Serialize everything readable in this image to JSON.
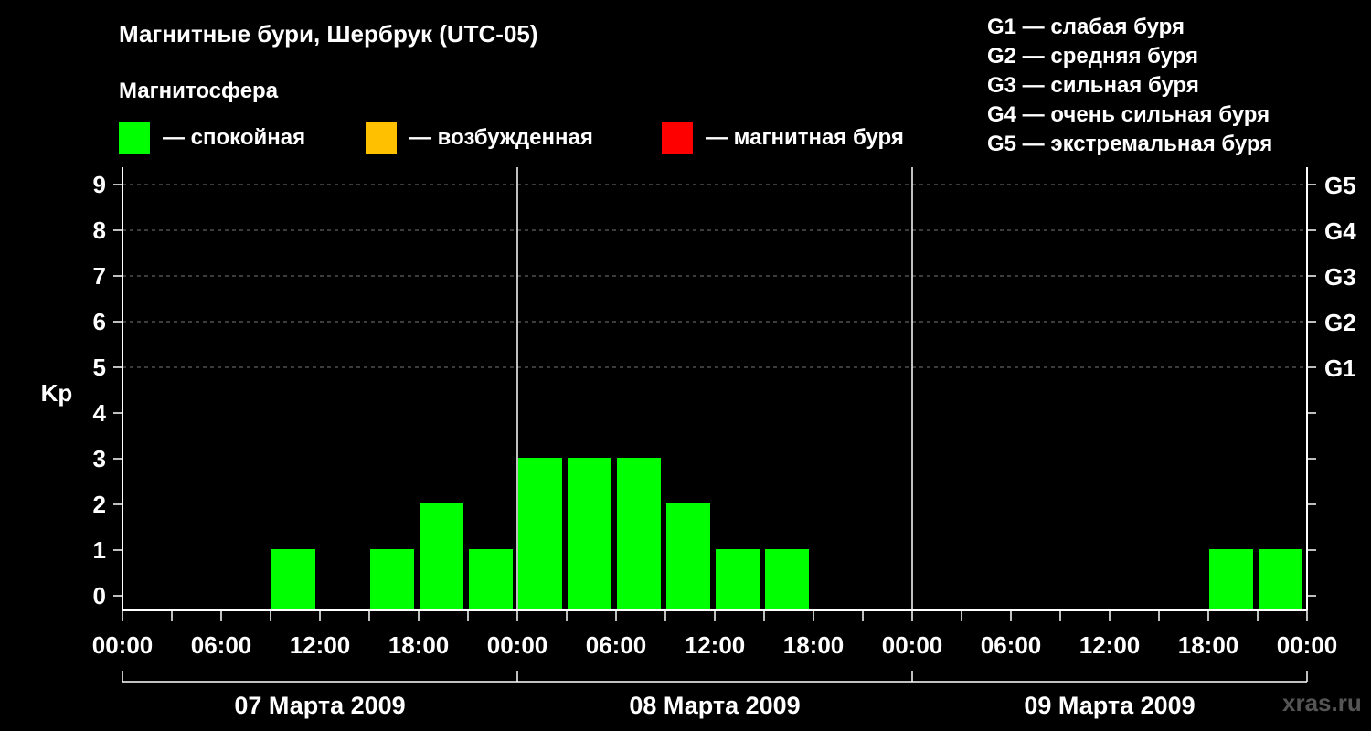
{
  "header": {
    "title": "Магнитные бури, Шербрук (UTC-05)",
    "subtitle": "Магнитосфера"
  },
  "legend": [
    {
      "label": "— спокойная",
      "color": "#00ff00"
    },
    {
      "label": "— возбужденная",
      "color": "#ffc000"
    },
    {
      "label": "— магнитная буря",
      "color": "#ff0000"
    }
  ],
  "g_scale": [
    "G1 — слабая буря",
    "G2 — средняя буря",
    "G3 — сильная буря",
    "G4 — очень сильная буря",
    "G5 — экстремальная буря"
  ],
  "watermark": "xras.ru",
  "chart_data": {
    "type": "bar",
    "ylabel": "Kp",
    "ylim": [
      0,
      9
    ],
    "yticks": [
      "0",
      "1",
      "2",
      "3",
      "4",
      "5",
      "6",
      "7",
      "8",
      "9"
    ],
    "right_axis": [
      {
        "kp": 5,
        "label": "G1"
      },
      {
        "kp": 6,
        "label": "G2"
      },
      {
        "kp": 7,
        "label": "G3"
      },
      {
        "kp": 8,
        "label": "G4"
      },
      {
        "kp": 9,
        "label": "G5"
      }
    ],
    "grid": "dashed horizontal lines at Kp 5–9",
    "xtick_labels": [
      "00:00",
      "06:00",
      "12:00",
      "18:00",
      "00:00",
      "06:00",
      "12:00",
      "18:00",
      "00:00",
      "06:00",
      "12:00",
      "18:00",
      "00:00"
    ],
    "days": [
      "07 Марта 2009",
      "08 Марта 2009",
      "09 Марта 2009"
    ],
    "interval_hours": 3,
    "kp_values": [
      0,
      0,
      0,
      1,
      0,
      1,
      2,
      1,
      3,
      3,
      3,
      2,
      1,
      1,
      0,
      0,
      0,
      0,
      0,
      0,
      0,
      0,
      1,
      1
    ],
    "colors": {
      "quiet": "#00ff00",
      "active": "#ffc000",
      "storm": "#ff0000"
    }
  }
}
